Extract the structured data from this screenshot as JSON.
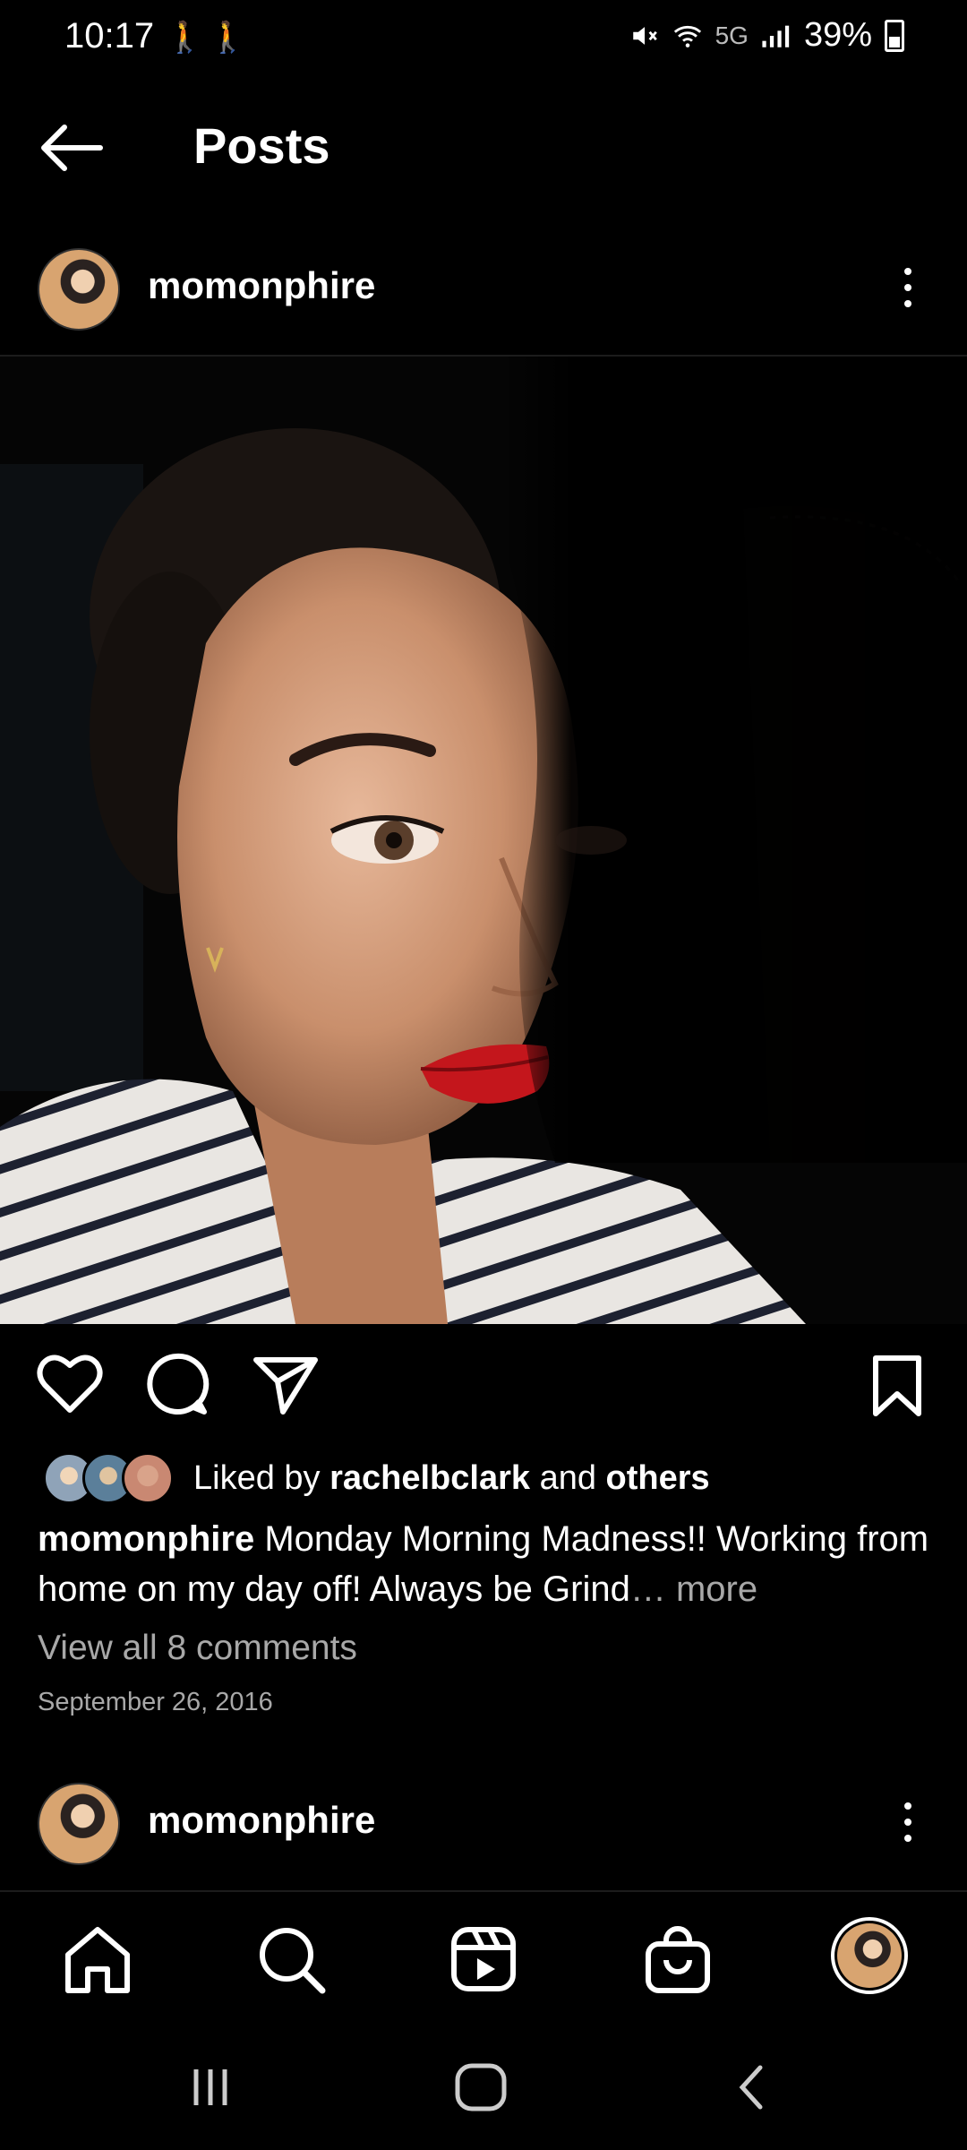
{
  "status_bar": {
    "time": "10:17",
    "walk_icons": "🚶🚶",
    "network": "5G",
    "battery": "39%"
  },
  "header": {
    "title": "Posts"
  },
  "post": {
    "username": "momonphire",
    "liked_by_prefix": "Liked by ",
    "liked_by_user": "rachelbclark",
    "liked_by_middle": " and ",
    "liked_by_others": "others",
    "caption_user": "momonphire",
    "caption_text": " Monday Morning Madness!! Working from home on my day off! Always be Grind",
    "caption_more": "… more",
    "view_comments": "View all 8 comments",
    "date": "September 26, 2016"
  },
  "next_post": {
    "username": "momonphire"
  },
  "icons": {
    "back": "arrow-left-icon",
    "like": "heart-icon",
    "comment": "comment-bubble-icon",
    "share": "paper-plane-icon",
    "save": "bookmark-icon",
    "home": "home-icon",
    "search": "search-icon",
    "reels": "reels-icon",
    "shop": "shopping-bag-icon"
  },
  "colors": {
    "background": "#000000",
    "text": "#ffffff",
    "secondary_text": "#a8a8a8",
    "lipstick": "#c4161c"
  }
}
